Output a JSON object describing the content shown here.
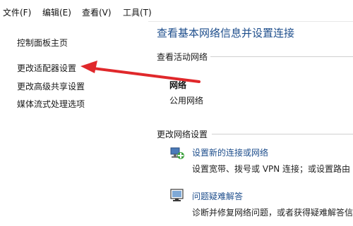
{
  "menubar": {
    "items": [
      "文件(F)",
      "编辑(E)",
      "查看(V)",
      "工具(T)"
    ]
  },
  "sidebar": {
    "links": [
      "控制面板主页",
      "更改适配器设置",
      "更改高级共享设置",
      "媒体流式处理选项"
    ]
  },
  "main": {
    "title": "查看基本网络信息并设置连接",
    "active_networks_label": "查看活动网络",
    "network_name": "网络",
    "network_type": "公用网络",
    "change_settings_label": "更改网络设置",
    "tasks": [
      {
        "icon": "network-setup-icon",
        "title": "设置新的连接或网络",
        "desc": "设置宽带、拨号或 VPN 连接；或设置路由"
      },
      {
        "icon": "troubleshoot-icon",
        "title": "问题疑难解答",
        "desc": "诊断并修复网络问题，或者获得疑难解答信"
      }
    ]
  },
  "colors": {
    "link_blue": "#1e4e8c",
    "arrow_red": "#e0282b"
  }
}
